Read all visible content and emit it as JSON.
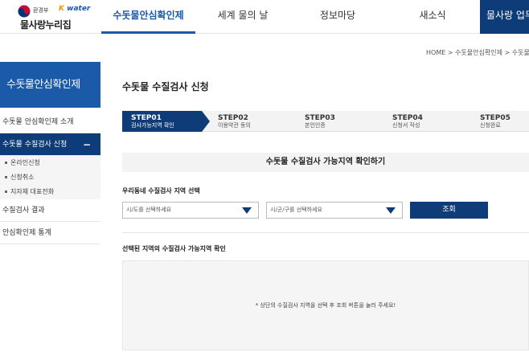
{
  "header": {
    "logo_org": "환경부",
    "logo_brand_k": "K",
    "logo_brand_rest": "water",
    "site_name": "물사랑누리집",
    "emblem_icon": "taegeuk-emblem-icon",
    "menus": [
      {
        "label": "수돗물안심확인제",
        "active": true
      },
      {
        "label": "세계 물의 날",
        "active": false
      },
      {
        "label": "정보마당",
        "active": false
      },
      {
        "label": "새소식",
        "active": false
      },
      {
        "label": "물사랑 업무",
        "active": false
      }
    ]
  },
  "breadcrumb": "HOME > 수돗물안심확인제 > 수돗물 수",
  "sidebar": {
    "title": "수돗물안심확인제",
    "items": [
      {
        "label": "수돗물 안심확인제 소개"
      },
      {
        "label": "수돗물 수질검사 신청",
        "toggle": "−"
      },
      {
        "label": "수질검사 결과"
      },
      {
        "label": "안심확인제 통계"
      }
    ],
    "subitems": [
      {
        "label": "온라인신청"
      },
      {
        "label": "신청취소"
      },
      {
        "label": "지자체 대표전화"
      }
    ]
  },
  "main": {
    "title": "수돗물 수질검사 신청",
    "steps": [
      {
        "num": "STEP01",
        "label": "검사가능지역 확인",
        "active": true
      },
      {
        "num": "STEP02",
        "label": "이용약관 동의",
        "active": false
      },
      {
        "num": "STEP03",
        "label": "본인인증",
        "active": false
      },
      {
        "num": "STEP04",
        "label": "신청서 작성",
        "active": false
      },
      {
        "num": "STEP05",
        "label": "신청완료",
        "active": false
      }
    ],
    "section_title": "수돗물 수질검사 가능지역 확인하기",
    "region_label": "우리동네 수질검사 지역 선택",
    "select_city_placeholder": "시/도를 선택하세요",
    "select_district_placeholder": "시/군/구를 선택하세요",
    "search_button": "조회",
    "result_label": "선택된 지역의 수질검사 가능지역 확인",
    "result_message": "* 상단의 수질검사 지역을 선택 후 조회 버튼을 눌러 주세요!"
  },
  "colors": {
    "primary": "#1a5aa8",
    "dark": "#0d3c78"
  }
}
